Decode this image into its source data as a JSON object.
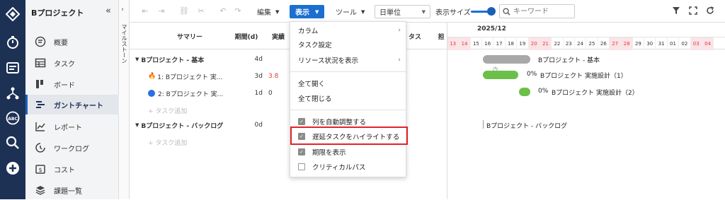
{
  "project": {
    "title": "Bプロジェクト"
  },
  "sidebar": {
    "collapse": "«",
    "items": [
      {
        "label": "概要",
        "icon": "overview-icon"
      },
      {
        "label": "タスク",
        "icon": "table-icon"
      },
      {
        "label": "ボード",
        "icon": "board-icon"
      },
      {
        "label": "ガントチャート",
        "icon": "gantt-icon"
      },
      {
        "label": "レポート",
        "icon": "report-icon"
      },
      {
        "label": "ワークログ",
        "icon": "worklog-icon"
      },
      {
        "label": "コスト",
        "icon": "cost-icon"
      },
      {
        "label": "課題一覧",
        "icon": "issues-icon"
      }
    ]
  },
  "milestone_label": "マイルストーン",
  "toolbar": {
    "edit": "編集",
    "view": "表示",
    "tools": "ツール",
    "unit": "日単位",
    "size_label": "表示サイズ",
    "search_placeholder": "キーワード"
  },
  "grid": {
    "headers": {
      "summary": "サマリー",
      "duration": "期間(d)",
      "actual": "実績",
      "status": "タス",
      "extra": "担"
    },
    "rows": [
      {
        "name": "Bプロジェクト - 基本",
        "dur": "4d",
        "act": ""
      },
      {
        "name": "1: Bプロジェクト 実...",
        "dur": "3d",
        "act": "3.8"
      },
      {
        "name": "2: Bプロジェクト 実...",
        "dur": "1d",
        "act": "0"
      },
      {
        "name": "+ タスク追加"
      },
      {
        "name": "Bプロジェクト - バックログ",
        "dur": "0d",
        "act": ""
      },
      {
        "name": "+ タスク追加"
      }
    ]
  },
  "gantt": {
    "month": "2025/12",
    "days": [
      "13",
      "14",
      "15",
      "16",
      "17",
      "18",
      "19",
      "20",
      "21",
      "22",
      "23",
      "24",
      "25",
      "26",
      "27",
      "28",
      "29",
      "30",
      "31",
      "01",
      "02",
      "03",
      "04"
    ],
    "weekend": [
      true,
      true,
      false,
      false,
      false,
      false,
      false,
      true,
      true,
      false,
      false,
      false,
      false,
      false,
      true,
      true,
      false,
      false,
      false,
      false,
      false,
      true,
      true
    ],
    "bars": [
      {
        "label": "Bプロジェクト - 基本",
        "pct": ""
      },
      {
        "label": "Bプロジェクト 実施設計（1）",
        "pct": "0%"
      },
      {
        "label": "Bプロジェクト 実施設計（2）",
        "pct": "0%"
      },
      {
        "label": "Bプロジェクト - バックログ",
        "pct": ""
      }
    ]
  },
  "menu": {
    "items": [
      {
        "label": "カラム",
        "arrow": "›"
      },
      {
        "label": "タスク設定"
      },
      {
        "label": "リソース状況を表示",
        "arrow": "›"
      },
      {
        "label": "全て開く"
      },
      {
        "label": "全て閉じる"
      },
      {
        "label": "列を自動調整する",
        "checked": true
      },
      {
        "label": "遅延タスクをハイライトする",
        "checked": true
      },
      {
        "label": "期限を表示",
        "checked": true
      },
      {
        "label": "クリティカルパス",
        "checked": false
      }
    ]
  }
}
